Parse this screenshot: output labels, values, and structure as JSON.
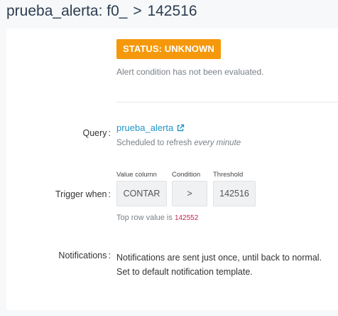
{
  "header": {
    "alert_name": "prueba_alerta:",
    "column": "f0_",
    "separator": ">",
    "threshold": "142516"
  },
  "status": {
    "badge": "STATUS: UNKNOWN",
    "badge_color": "#f5980b",
    "description": "Alert condition has not been evaluated."
  },
  "query": {
    "label": "Query",
    "link_text": "prueba_alerta",
    "link_icon": "external-link-icon",
    "link_color": "#2196c8",
    "schedule_prefix": "Scheduled to refresh",
    "schedule_value": "every minute"
  },
  "trigger": {
    "label": "Trigger when",
    "value_column_caption": "Value column",
    "value_column": "CONTAR",
    "condition_caption": "Condition",
    "condition": ">",
    "threshold_caption": "Threshold",
    "threshold": "142516",
    "top_row_prefix": "Top row value is",
    "top_row_value": "142552"
  },
  "notifications": {
    "label": "Notifications",
    "line1": "Notifications are sent just once, until back to normal.",
    "line2": "Set to default notification template."
  }
}
